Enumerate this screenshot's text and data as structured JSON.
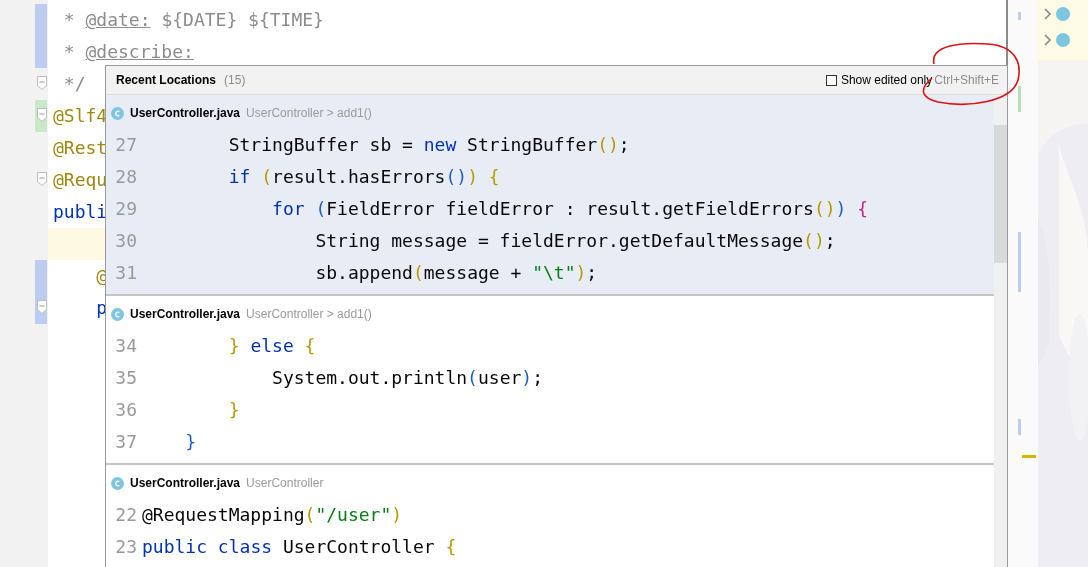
{
  "editor": {
    "lines": [
      {
        "color": "#bccdf0",
        "fold": false,
        "segments": [
          {
            "text": " * ",
            "kind": "comment"
          },
          {
            "text": "@date:",
            "kind": "doctag"
          },
          {
            "text": " ${DATE} ${TIME}",
            "kind": "comment"
          }
        ]
      },
      {
        "color": "#bccdf0",
        "fold": false,
        "segments": [
          {
            "text": " * ",
            "kind": "comment"
          },
          {
            "text": "@describe:",
            "kind": "doctag"
          }
        ]
      },
      {
        "fold": true,
        "segments": [
          {
            "text": " */",
            "kind": "comment"
          }
        ]
      },
      {
        "color": "#c9e7c9",
        "fold": true,
        "segments": [
          {
            "text": "@Slf4",
            "kind": "ann"
          }
        ]
      },
      {
        "fold": false,
        "segments": [
          {
            "text": "@Rest",
            "kind": "ann"
          }
        ]
      },
      {
        "fold": true,
        "segments": [
          {
            "text": "@Requ",
            "kind": "ann"
          }
        ]
      },
      {
        "fold": false,
        "segments": [
          {
            "text": "publi",
            "kind": "kw"
          }
        ]
      },
      {
        "fold": false,
        "highlighted": true
      },
      {
        "color": "#bccdf0",
        "fold": false,
        "segments": [
          {
            "text": "    @",
            "kind": "ann"
          }
        ]
      },
      {
        "color": "#bccdf0",
        "fold": true,
        "segments": [
          {
            "text": "    p",
            "kind": "kw"
          }
        ]
      }
    ]
  },
  "popup": {
    "title": "Recent Locations",
    "count": "(15)",
    "show_edited_only": {
      "label": "Show edited only",
      "checked": false
    },
    "shortcut": "Ctrl+Shift+E",
    "locations": [
      {
        "file": "UserController.java",
        "context": "UserController > add1()",
        "selected": true,
        "lines": [
          {
            "number": "27",
            "segments": [
              {
                "text": "        StringBuffer sb = ",
                "kind": "plain"
              },
              {
                "text": "new",
                "kind": "kw"
              },
              {
                "text": " StringBuffer",
                "kind": "plain"
              },
              {
                "text": "()",
                "kind": "p1"
              },
              {
                "text": ";",
                "kind": "plain"
              }
            ]
          },
          {
            "number": "28",
            "segments": [
              {
                "text": "        if",
                "kind": "kw"
              },
              {
                "text": " (",
                "kind": "p1"
              },
              {
                "text": "result.hasErrors",
                "kind": "plain"
              },
              {
                "text": "()",
                "kind": "p2"
              },
              {
                "text": ") {",
                "kind": "p1"
              }
            ]
          },
          {
            "number": "29",
            "segments": [
              {
                "text": "            for",
                "kind": "kw"
              },
              {
                "text": " (",
                "kind": "p2"
              },
              {
                "text": "FieldError fieldError : result.getFieldErrors",
                "kind": "plain"
              },
              {
                "text": "()",
                "kind": "p1"
              },
              {
                "text": ")",
                "kind": "p2"
              },
              {
                "text": " {",
                "kind": "p3"
              }
            ]
          },
          {
            "number": "30",
            "segments": [
              {
                "text": "                String message = fieldError.getDefaultMessage",
                "kind": "plain"
              },
              {
                "text": "()",
                "kind": "p1"
              },
              {
                "text": ";",
                "kind": "plain"
              }
            ]
          },
          {
            "number": "31",
            "segments": [
              {
                "text": "                sb.append",
                "kind": "plain"
              },
              {
                "text": "(",
                "kind": "p1"
              },
              {
                "text": "message + ",
                "kind": "plain"
              },
              {
                "text": "\"\\t\"",
                "kind": "str"
              },
              {
                "text": ")",
                "kind": "p1"
              },
              {
                "text": ";",
                "kind": "plain"
              }
            ]
          }
        ]
      },
      {
        "file": "UserController.java",
        "context": "UserController > add1()",
        "selected": false,
        "lines": [
          {
            "number": "34",
            "segments": [
              {
                "text": "        }",
                "kind": "p1"
              },
              {
                "text": " else",
                "kind": "kw"
              },
              {
                "text": " {",
                "kind": "p1"
              }
            ]
          },
          {
            "number": "35",
            "segments": [
              {
                "text": "            System.out.println",
                "kind": "plain"
              },
              {
                "text": "(",
                "kind": "p2"
              },
              {
                "text": "user",
                "kind": "plain"
              },
              {
                "text": ")",
                "kind": "p2"
              },
              {
                "text": ";",
                "kind": "plain"
              }
            ]
          },
          {
            "number": "36",
            "segments": [
              {
                "text": "        }",
                "kind": "p1"
              }
            ]
          },
          {
            "number": "37",
            "segments": [
              {
                "text": "    }",
                "kind": "p2"
              }
            ]
          }
        ]
      },
      {
        "file": "UserController.java",
        "context": "UserController",
        "selected": false,
        "lines": [
          {
            "number": "22",
            "segments": [
              {
                "text": "@RequestMapping",
                "kind": "plain"
              },
              {
                "text": "(",
                "kind": "p1"
              },
              {
                "text": "\"/user\"",
                "kind": "str"
              },
              {
                "text": ")",
                "kind": "p1"
              }
            ]
          },
          {
            "number": "23",
            "segments": [
              {
                "text": "public",
                "kind": "kw"
              },
              {
                "text": " class",
                "kind": "kw"
              },
              {
                "text": " UserController ",
                "kind": "plain"
              },
              {
                "text": "{",
                "kind": "p1"
              }
            ]
          }
        ]
      }
    ]
  }
}
